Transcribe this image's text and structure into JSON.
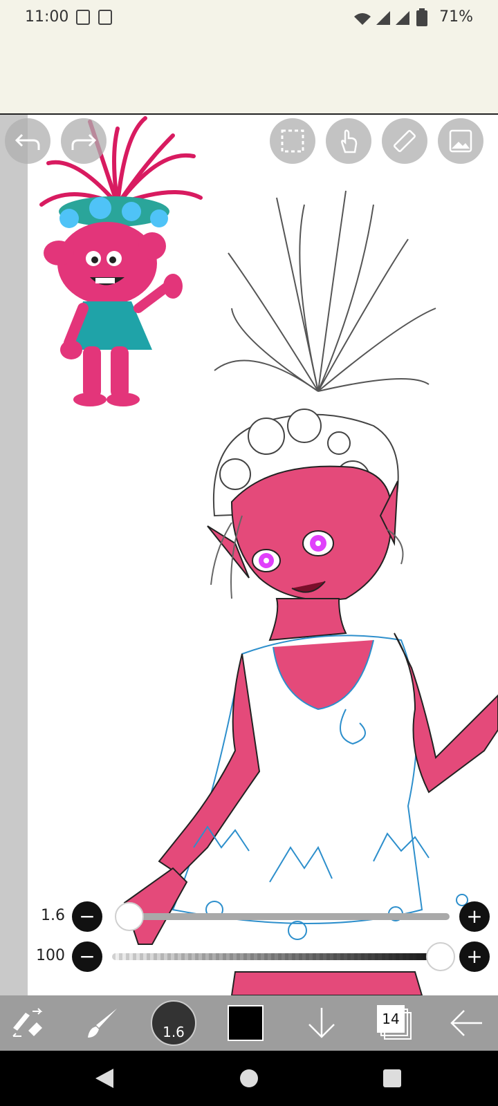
{
  "status_bar": {
    "time": "11:00",
    "battery_percent": "71%"
  },
  "sliders": {
    "brush_size": {
      "value_label": "1.6",
      "fraction": 0.0
    },
    "opacity": {
      "value_label": "100",
      "fraction": 1.0
    }
  },
  "toolbar": {
    "brush_size_label": "1.6",
    "current_color": "#000000",
    "layer_count": "14"
  },
  "icons": {
    "undo": "undo-icon",
    "redo": "redo-icon",
    "selection": "selection-icon",
    "hand": "hand-tool-icon",
    "ruler": "ruler-icon",
    "material": "image-icon"
  },
  "colors": {
    "status_bg": "#f4f3e8",
    "skin": "#e44a7a",
    "slider_track": "#a9a9a9"
  }
}
